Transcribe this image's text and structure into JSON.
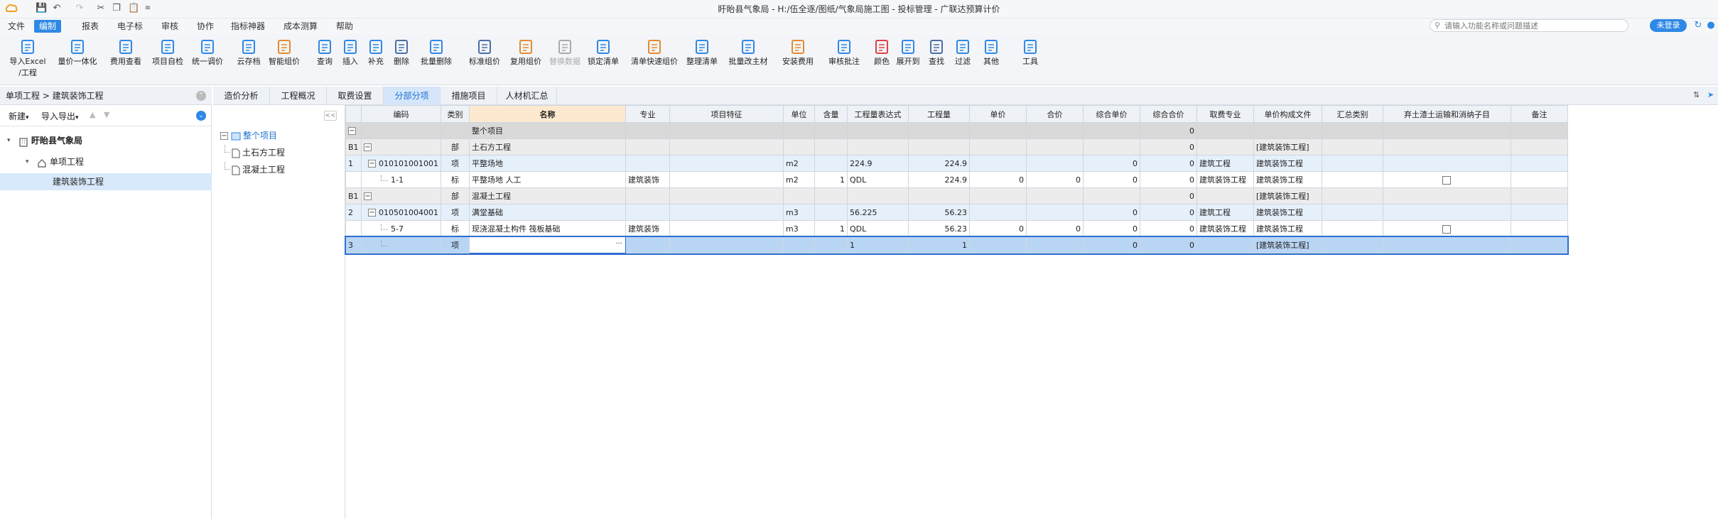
{
  "window": {
    "title": "盱眙县气象局 - H:/伍全逐/图纸/气象局施工图 - 投标管理 - 广联达预算计价"
  },
  "menu": {
    "items": [
      "文件",
      "编制",
      "报表",
      "电子标",
      "审核",
      "协作",
      "指标神器",
      "成本测算",
      "帮助"
    ],
    "active_index": 1
  },
  "search": {
    "placeholder": "请输入功能名称或问题描述"
  },
  "login": {
    "label": "未登录"
  },
  "ribbon": {
    "tools": [
      {
        "label": "导入Excel",
        "label2": "/工程",
        "icon": "import-excel-icon"
      },
      {
        "label": "量价一体化",
        "icon": "quantity-price-icon"
      },
      {
        "label": "费用查看",
        "icon": "cost-view-icon"
      },
      {
        "label": "项目自检",
        "icon": "self-check-icon"
      },
      {
        "label": "统一调价",
        "icon": "price-adjust-icon"
      },
      {
        "label": "云存档",
        "icon": "cloud-archive-icon"
      },
      {
        "label": "智能组价",
        "icon": "smart-pricing-icon"
      },
      {
        "label": "查询",
        "icon": "query-icon"
      },
      {
        "label": "插入",
        "icon": "insert-icon"
      },
      {
        "label": "补充",
        "icon": "supplement-icon"
      },
      {
        "label": "删除",
        "icon": "delete-icon"
      },
      {
        "label": "批量删除",
        "icon": "batch-delete-icon"
      },
      {
        "label": "标准组价",
        "icon": "standard-pricing-icon"
      },
      {
        "label": "复用组价",
        "icon": "reuse-pricing-icon"
      },
      {
        "label": "替换数据",
        "icon": "replace-data-icon",
        "disabled": true
      },
      {
        "label": "锁定清单",
        "icon": "lock-list-icon"
      },
      {
        "label": "清单快速组价",
        "icon": "quick-pricing-icon"
      },
      {
        "label": "整理清单",
        "icon": "organize-list-icon"
      },
      {
        "label": "批量改主材",
        "icon": "batch-material-icon"
      },
      {
        "label": "安装费用",
        "icon": "install-cost-icon"
      },
      {
        "label": "审核批注",
        "icon": "review-note-icon"
      },
      {
        "label": "颜色",
        "icon": "color-icon"
      },
      {
        "label": "展开到",
        "icon": "expand-to-icon"
      },
      {
        "label": "查找",
        "icon": "find-icon"
      },
      {
        "label": "过滤",
        "icon": "filter-icon"
      },
      {
        "label": "其他",
        "icon": "other-icon"
      },
      {
        "label": "工具",
        "icon": "tools-icon"
      }
    ]
  },
  "left_panel": {
    "breadcrumb": "单项工程 > 建筑装饰工程",
    "new_label": "新建",
    "import_export_label": "导入导出",
    "tree": [
      {
        "label": "盱眙县气象局",
        "level": 0,
        "icon": "building-icon"
      },
      {
        "label": "单项工程",
        "level": 1,
        "icon": "house-icon"
      },
      {
        "label": "建筑装饰工程",
        "level": 2,
        "icon": ""
      }
    ]
  },
  "mid_panel": {
    "tree": [
      {
        "label": "整个项目",
        "level": 0
      },
      {
        "label": "土石方工程",
        "level": 1
      },
      {
        "label": "混凝土工程",
        "level": 1
      }
    ]
  },
  "tabs": {
    "items": [
      "造价分析",
      "工程概况",
      "取费设置",
      "分部分项",
      "措施项目",
      "人材机汇总"
    ],
    "active_index": 3
  },
  "grid": {
    "columns": [
      "",
      "编码",
      "类别",
      "名称",
      "专业",
      "项目特征",
      "单位",
      "含量",
      "工程量表达式",
      "工程量",
      "单价",
      "合价",
      "综合单价",
      "综合合价",
      "取费专业",
      "单价构成文件",
      "汇总类别",
      "弃土渣土运输和消纳子目",
      "备注"
    ],
    "rows": [
      {
        "idx": "",
        "code": "",
        "type": "",
        "name": "整个项目",
        "spec": "",
        "feature": "",
        "unit": "",
        "content": "",
        "expr": "",
        "qty": "",
        "price": "",
        "total": "",
        "unit_comp": "",
        "total_comp": "0",
        "fee": "",
        "file": "",
        "sum_type": "",
        "checkbox": false,
        "remark": "",
        "level": 0,
        "expander": true
      },
      {
        "idx": "B1",
        "code": "",
        "type": "部",
        "name": "土石方工程",
        "spec": "",
        "feature": "",
        "unit": "",
        "content": "",
        "expr": "",
        "qty": "",
        "price": "",
        "total": "",
        "unit_comp": "",
        "total_comp": "0",
        "fee": "",
        "file": "[建筑装饰工程]",
        "sum_type": "",
        "checkbox": false,
        "remark": "",
        "level": 1,
        "expander": true
      },
      {
        "idx": "1",
        "code": "010101001001",
        "type": "项",
        "name": "平整场地",
        "spec": "",
        "feature": "",
        "unit": "m2",
        "content": "",
        "expr": "224.9",
        "qty": "224.9",
        "price": "",
        "total": "",
        "unit_comp": "0",
        "total_comp": "0",
        "fee": "建筑工程",
        "file": "建筑装饰工程",
        "sum_type": "",
        "checkbox": false,
        "remark": "",
        "level": 2,
        "expander": true
      },
      {
        "idx": "",
        "code": "1-1",
        "type": "标",
        "name": "平整场地 人工",
        "spec": "建筑装饰",
        "feature": "",
        "unit": "m2",
        "content": "1",
        "expr": "QDL",
        "qty": "224.9",
        "price": "0",
        "total": "0",
        "unit_comp": "0",
        "total_comp": "0",
        "fee": "建筑装饰工程",
        "file": "建筑装饰工程",
        "sum_type": "",
        "checkbox": true,
        "remark": "",
        "level": 3,
        "expander": false
      },
      {
        "idx": "B1",
        "code": "",
        "type": "部",
        "name": "混凝土工程",
        "spec": "",
        "feature": "",
        "unit": "",
        "content": "",
        "expr": "",
        "qty": "",
        "price": "",
        "total": "",
        "unit_comp": "",
        "total_comp": "0",
        "fee": "",
        "file": "[建筑装饰工程]",
        "sum_type": "",
        "checkbox": false,
        "remark": "",
        "level": 1,
        "expander": true
      },
      {
        "idx": "2",
        "code": "010501004001",
        "type": "项",
        "name": "满堂基础",
        "spec": "",
        "feature": "",
        "unit": "m3",
        "content": "",
        "expr": "56.225",
        "qty": "56.23",
        "price": "",
        "total": "",
        "unit_comp": "0",
        "total_comp": "0",
        "fee": "建筑工程",
        "file": "建筑装饰工程",
        "sum_type": "",
        "checkbox": false,
        "remark": "",
        "level": 2,
        "expander": true
      },
      {
        "idx": "",
        "code": "5-7",
        "type": "标",
        "name": "现浇混凝土构件 筏板基础",
        "spec": "建筑装饰",
        "feature": "",
        "unit": "m3",
        "content": "1",
        "expr": "QDL",
        "qty": "56.23",
        "price": "0",
        "total": "0",
        "unit_comp": "0",
        "total_comp": "0",
        "fee": "建筑装饰工程",
        "file": "建筑装饰工程",
        "sum_type": "",
        "checkbox": true,
        "remark": "",
        "level": 3,
        "expander": false
      },
      {
        "idx": "3",
        "code": "",
        "type": "项",
        "name": "",
        "spec": "",
        "feature": "",
        "unit": "",
        "content": "",
        "expr": "1",
        "qty": "1",
        "price": "",
        "total": "",
        "unit_comp": "0",
        "total_comp": "0",
        "fee": "",
        "file": "[建筑装饰工程]",
        "sum_type": "",
        "checkbox": false,
        "remark": "",
        "level": 9,
        "expander": false
      }
    ]
  },
  "colors": {
    "accent": "#2e88e5",
    "header_name": "#fde9cf",
    "row_level0": "#d9d9d9",
    "row_level1": "#ececec",
    "row_level2": "#e6f0fb",
    "row_selected": "#b9d5f4"
  }
}
